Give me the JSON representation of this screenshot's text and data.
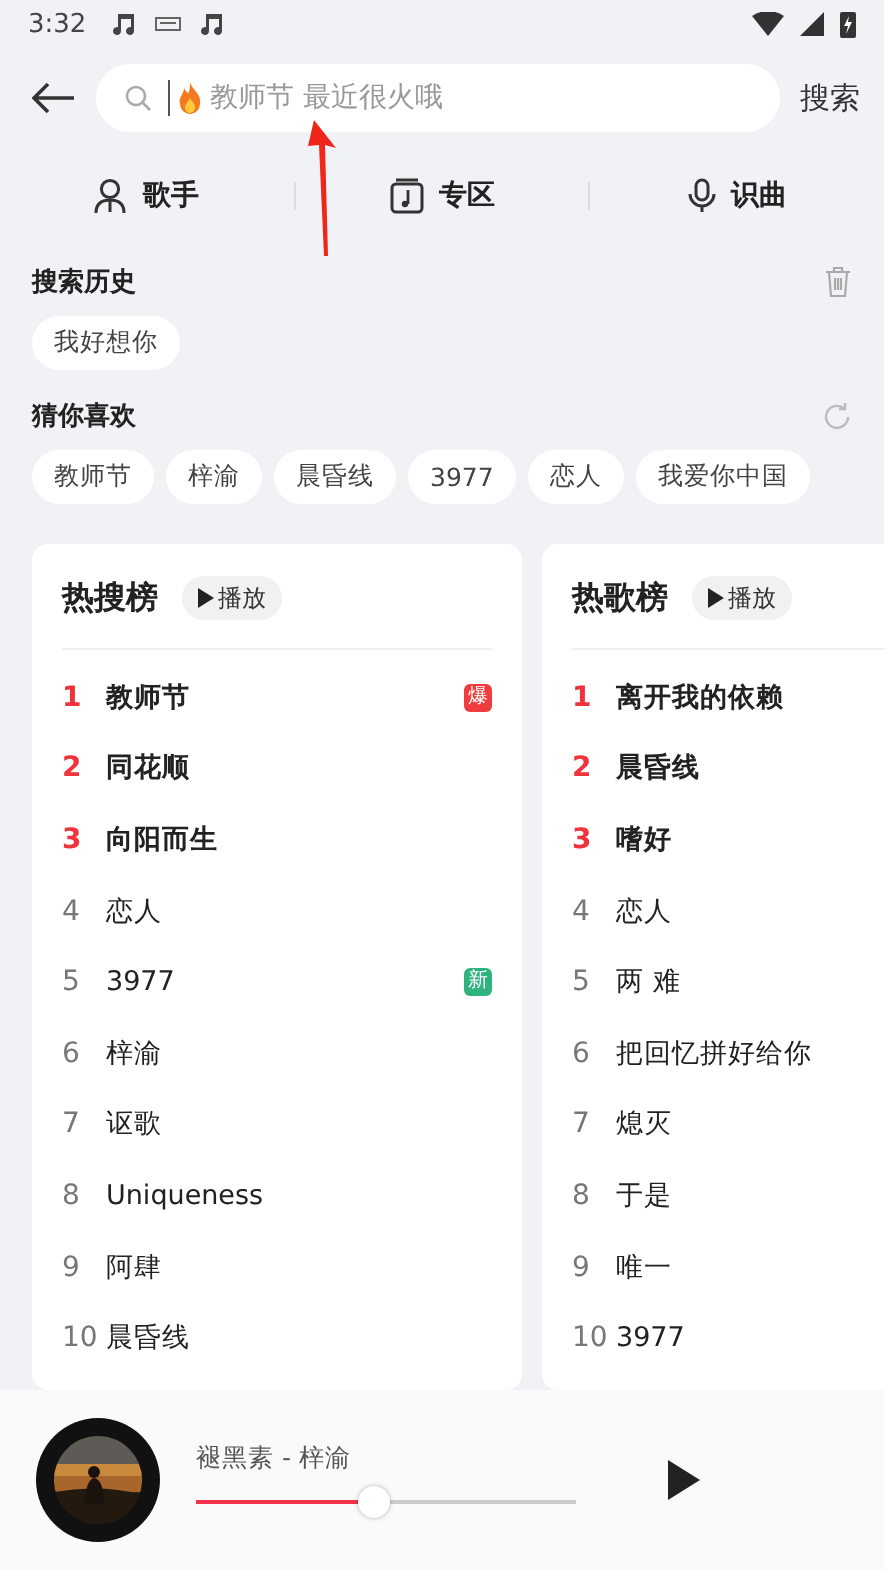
{
  "status_bar": {
    "time": "3:32"
  },
  "search": {
    "placeholder": "教师节 最近很火哦",
    "button": "搜索"
  },
  "tabs": [
    {
      "label": "歌手",
      "kind": "person"
    },
    {
      "label": "专区",
      "kind": "album"
    },
    {
      "label": "识曲",
      "kind": "mic"
    }
  ],
  "history": {
    "title": "搜索历史",
    "items": [
      "我好想你"
    ]
  },
  "suggestions": {
    "title": "猜你喜欢",
    "items": [
      "教师节",
      "梓渝",
      "晨昏线",
      "3977",
      "恋人",
      "我爱你中国"
    ]
  },
  "charts": [
    {
      "title": "热搜榜",
      "play": "播放",
      "rows": [
        {
          "rank": "1",
          "title": "教师节",
          "top": true,
          "badge": {
            "text": "爆",
            "color": "#f03c3c"
          }
        },
        {
          "rank": "2",
          "title": "同花顺",
          "top": true
        },
        {
          "rank": "3",
          "title": "向阳而生",
          "top": true
        },
        {
          "rank": "4",
          "title": "恋人",
          "top": false
        },
        {
          "rank": "5",
          "title": "3977",
          "top": false,
          "badge": {
            "text": "新",
            "color": "#2fb37e"
          }
        },
        {
          "rank": "6",
          "title": "梓渝",
          "top": false
        },
        {
          "rank": "7",
          "title": "讴歌",
          "top": false
        },
        {
          "rank": "8",
          "title": "Uniqueness",
          "top": false
        },
        {
          "rank": "9",
          "title": "阿肆",
          "top": false
        },
        {
          "rank": "10",
          "title": "晨昏线",
          "top": false
        }
      ]
    },
    {
      "title": "热歌榜",
      "play": "播放",
      "rows": [
        {
          "rank": "1",
          "title": "离开我的依赖",
          "top": true
        },
        {
          "rank": "2",
          "title": "晨昏线",
          "top": true
        },
        {
          "rank": "3",
          "title": "嗜好",
          "top": true
        },
        {
          "rank": "4",
          "title": "恋人",
          "top": false
        },
        {
          "rank": "5",
          "title": "两 难",
          "top": false
        },
        {
          "rank": "6",
          "title": "把回忆拼好给你",
          "top": false
        },
        {
          "rank": "7",
          "title": "熄灭",
          "top": false
        },
        {
          "rank": "8",
          "title": "于是",
          "top": false
        },
        {
          "rank": "9",
          "title": "唯一",
          "top": false
        },
        {
          "rank": "10",
          "title": "3977",
          "top": false
        }
      ]
    }
  ],
  "player": {
    "song": "褪黑素 - 梓渝",
    "level": 0.47
  }
}
